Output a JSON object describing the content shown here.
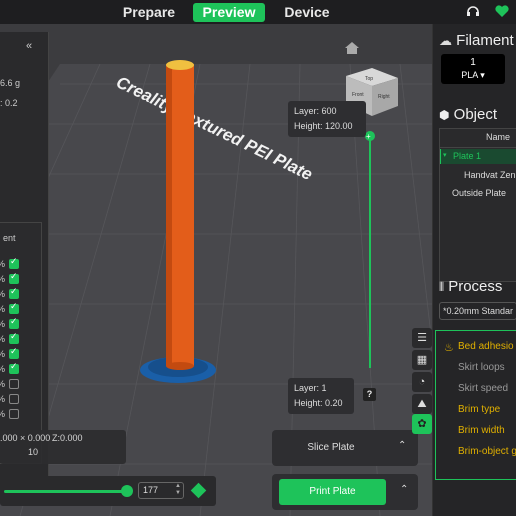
{
  "topbar": {
    "tabs": [
      {
        "label": "Prepare"
      },
      {
        "label": "Preview"
      },
      {
        "label": "Device"
      }
    ]
  },
  "plate_label": "Creality Textured PEI Plate",
  "left_panel": {
    "collapse_glyph": "«",
    "weight": "6.6 g",
    "value2": ": 0.2",
    "box_title": "ent",
    "rows": [
      {
        "suffix": "%",
        "checked": true
      },
      {
        "suffix": "%",
        "checked": true
      },
      {
        "suffix": "%",
        "checked": true
      },
      {
        "suffix": "%",
        "checked": true
      },
      {
        "suffix": "%",
        "checked": true
      },
      {
        "suffix": "%",
        "checked": true
      },
      {
        "suffix": "%",
        "checked": true
      },
      {
        "suffix": "%",
        "checked": true
      },
      {
        "suffix": "%",
        "checked": false
      },
      {
        "suffix": "%",
        "checked": false
      },
      {
        "suffix": "%",
        "checked": false
      }
    ]
  },
  "coords": {
    "xy": ".000 × 0.000",
    "z": "Z:0.000",
    "extra": "10"
  },
  "layer_top": {
    "layer": "Layer: 600",
    "height": "Height: 120.00"
  },
  "layer_bottom": {
    "layer": "Layer: 1",
    "height": "Height: 0.20"
  },
  "help_glyph": "?",
  "hslider": {
    "value": "177",
    "fraction": 0.58
  },
  "buttons": {
    "slice": "Slice Plate",
    "print": "Print Plate"
  },
  "right_panel": {
    "filament_header": "Filament",
    "filament_index": "1",
    "filament_type": "PLA ▾",
    "object_header": "Object",
    "object_col": "Name",
    "objects": [
      {
        "label": "Plate 1",
        "selected": true
      },
      {
        "label": "Handvat Zenu",
        "selected": false
      },
      {
        "label": "Outside Plate",
        "selected": false
      }
    ],
    "process_header": "Process",
    "process_preset": "*0.20mm Standar",
    "settings": [
      {
        "label": "Bed adhesio",
        "highlight": true
      },
      {
        "label": "Skirt loops",
        "highlight": false
      },
      {
        "label": "Skirt speed",
        "highlight": false
      },
      {
        "label": "Brim type",
        "highlight": true
      },
      {
        "label": "Brim width",
        "highlight": true
      },
      {
        "label": "Brim-object ga",
        "highlight": true
      }
    ]
  },
  "colors": {
    "accent": "#1ec35a",
    "model": "#e35d1a",
    "highlight": "#e0b000"
  }
}
